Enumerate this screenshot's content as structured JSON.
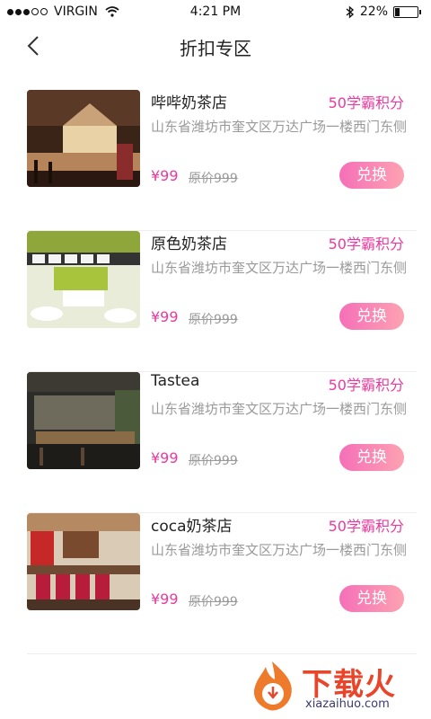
{
  "status_bar": {
    "carrier": "VIRGIN",
    "time": "4:21 PM",
    "battery": "22%",
    "battery_level": 0.22
  },
  "nav": {
    "title": "折扣专区"
  },
  "items": [
    {
      "name": "哔哔奶茶店",
      "points": "50学霸积分",
      "address": "山东省潍坊市奎文区万达广场一楼西门东侧",
      "price": "¥99",
      "original_price": "原价999",
      "button": "兑换"
    },
    {
      "name": "原色奶茶店",
      "points": "50学霸积分",
      "address": "山东省潍坊市奎文区万达广场一楼西门东侧",
      "price": "¥99",
      "original_price": "原价999",
      "button": "兑换"
    },
    {
      "name": "Tastea",
      "points": "50学霸积分",
      "address": "山东省潍坊市奎文区万达广场一楼西门东侧",
      "price": "¥99",
      "original_price": "原价999",
      "button": "兑换"
    },
    {
      "name": "coca奶茶店",
      "points": "50学霸积分",
      "address": "山东省潍坊市奎文区万达广场一楼西门东侧",
      "price": "¥99",
      "original_price": "原价999",
      "button": "兑换"
    }
  ],
  "watermark": {
    "text": "下载火",
    "url": "xiazaihuo.com"
  }
}
